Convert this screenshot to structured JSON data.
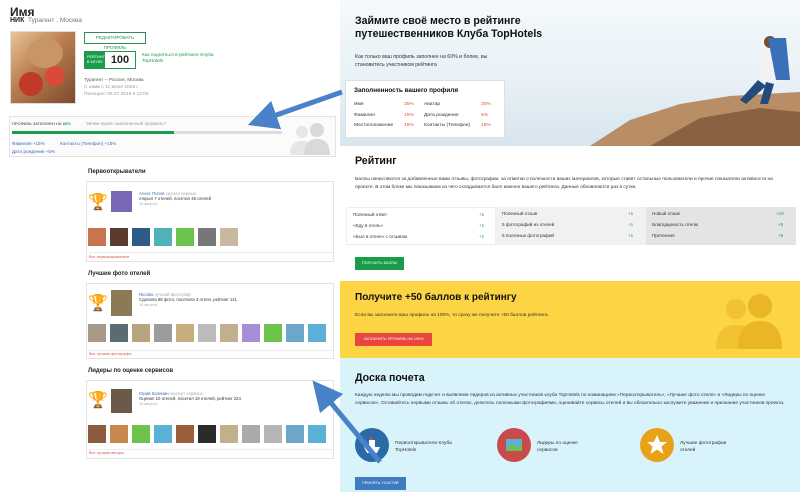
{
  "profile": {
    "name": "Имя",
    "nick": "НИК",
    "meta": "Турагент , Москва",
    "edit_button": "РЕДАКТИРОВАТЬ ПРОФИЛЬ",
    "rank_label": "РЕЙТИНГ В КЛУБЕ",
    "rank_value": "100",
    "rank_text": "Как подняться в рейтинге Клуба TopHotels",
    "info_line1": "Турагент – Россия, Москва",
    "info_line2": "С нами с 11 июня 2019 г.",
    "info_line3": "Посещал: 05.07.2019 в 12:00"
  },
  "fill": {
    "label_prefix": "ПРОФИЛЬ ЗАПОЛНЕН НА",
    "label_pct": "60%",
    "question": "Зачем нужен заполненный профиль?",
    "progress": 0.6,
    "items": [
      "Фамилия +15%",
      "Контакты (Телефон) +15%",
      "Дата рождения +5%"
    ]
  },
  "sections": [
    {
      "title": "Первооткрыватели",
      "user": "Алекс Попов",
      "user_suffix": " сделал первые",
      "text": "открыл 7 отелей, посетил 46 отелей",
      "date": "18 августа",
      "link": "Все первооткрыватели"
    },
    {
      "title": "Лучшие фото отелей",
      "user": "Nicolas",
      "user_suffix": " лучший фотограф",
      "text": "Сделала 88 фото, посетила 3 отеля, рейтинг 141",
      "date": "18 августа",
      "link": "Все лучшие фотографы"
    },
    {
      "title": "Лидеры по оценке сервисов",
      "user": "Юрий Калинин",
      "user_suffix": " эксперт сервиса",
      "text": "Оценил 10 отелей, посетил 19 отелей, рейтинг 224",
      "date": "18 августа",
      "link": "Все лучшие авторы"
    }
  ],
  "hero": {
    "title": "Займите своё место в рейтинге путешественников Клуба TopHotels",
    "subtitle": "Как только ваш профиль заполнен на 60% и более, вы становитесь участником рейтинга"
  },
  "fill_card": {
    "title": "Заполненность вашего профиля",
    "rows": [
      {
        "label": "Имя",
        "pct": "25%",
        "label2": "Аватар",
        "pct2": "20%"
      },
      {
        "label": "Фамилия",
        "pct": "15%",
        "label2": "Дата рождения",
        "pct2": "5%"
      },
      {
        "label": "Местоположение",
        "pct": "15%",
        "label2": "Контакты (Телефон)",
        "pct2": "15%"
      }
    ]
  },
  "rating": {
    "title": "Рейтинг",
    "desc": "Баллы начисляются за добавленные вами отзывы, фотографии, за отметки о полезности ваших материалов, которые ставят остальные пользователи и прочие показатели активности на проекте. В этом блоке мы показываем из чего складывается балл именно вашего рейтинга. Данные обновляются раз в сутки.",
    "col1": [
      {
        "label": "Полезный ответ",
        "val": "+1"
      },
      {
        "label": "«Еду в отель»",
        "val": "+1"
      },
      {
        "label": "«Был в отеле» с отзывом",
        "val": "+1"
      }
    ],
    "col2": [
      {
        "label": "Полезный отзыв",
        "val": "+1"
      },
      {
        "label": "5 фотографий из отелей",
        "val": "+1"
      },
      {
        "label": "5 полезных фотографий",
        "val": "+1"
      }
    ],
    "col3": [
      {
        "label": "Новый отзыв",
        "val": "+10"
      },
      {
        "label": "Благодарность отелю",
        "val": "+5"
      },
      {
        "label": "Претензия",
        "val": "+5"
      }
    ],
    "button": "ПОЛУЧИТЬ БАЛЛЫ"
  },
  "bonus": {
    "title": "Получите +50 баллов к рейтингу",
    "desc": "Если вы заполните ваш профиль на 100%, то сразу же получите +50 баллов рейтинга.",
    "button": "ЗАПОЛНИТЬ ПРОФИЛЬ НА 100%"
  },
  "honor": {
    "title": "Доска почета",
    "desc": "Каждую неделю мы проводим подсчет и выявляем лидеров из активных участников клуба TopHotels по номинациям «Первооткрыватель», «Лучшие фото отеля» и «Лидеры по оценке сервисов». Оставайтесь первыми отзывы об отелях, делитесь полезными фотографиями, оценивайте сервисы отелей и вы обязательно заслужите уважение и признание участников проекта.",
    "cat1": "Первооткрыватели Клуба TopHotels",
    "cat2": "Лидеры по оценке сервисов",
    "cat3": "Лучшие фотографии отелей",
    "button": "ПРИНЯТЬ УЧАСТИЕ"
  },
  "colors": {
    "green": "#1a9c4a",
    "red": "#e8463f",
    "yellow": "#fcd444",
    "blue": "#3e7bc1",
    "light_blue_bg": "#d9f3fb",
    "arrow": "#4a82c9"
  }
}
